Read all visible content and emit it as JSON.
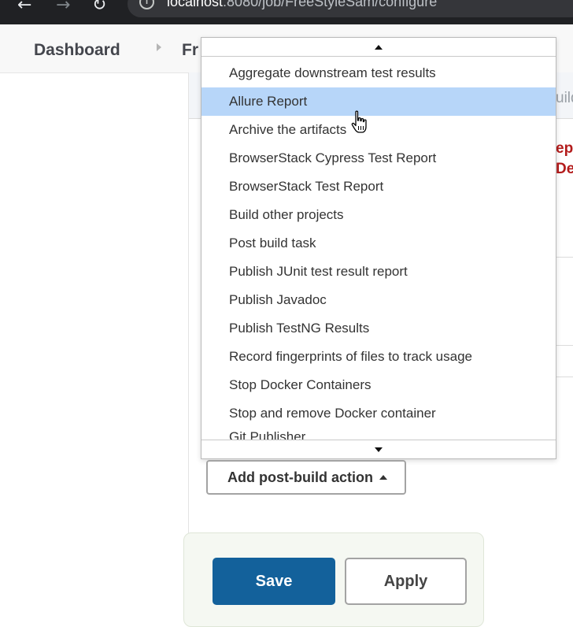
{
  "browser": {
    "back_glyph": "←",
    "forward_glyph": "→",
    "reload_glyph": "↻",
    "info_glyph": "i",
    "url_host": "localhost",
    "url_path": ":8080/job/FreeStyleSam/configure"
  },
  "breadcrumb": {
    "dashboard": "Dashboard",
    "job_partial": "Fr"
  },
  "background": {
    "band_partial": "uild",
    "error_line1": "ep",
    "error_line2": "De"
  },
  "dropdown": {
    "items": [
      "Aggregate downstream test results",
      "Allure Report",
      "Archive the artifacts",
      "BrowserStack Cypress Test Report",
      "BrowserStack Test Report",
      "Build other projects",
      "Post build task",
      "Publish JUnit test result report",
      "Publish Javadoc",
      "Publish TestNG Results",
      "Record fingerprints of files to track usage",
      "Stop Docker Containers",
      "Stop and remove Docker container",
      "Git Publisher"
    ],
    "highlighted_index": 1,
    "highlight_color": "#b7d6f9"
  },
  "actions": {
    "add_post_build": "Add post-build action",
    "save": "Save",
    "apply": "Apply"
  },
  "colors": {
    "save_bg": "#13619b",
    "error_red": "#b31b1b",
    "chrome_dark": "#202124"
  }
}
